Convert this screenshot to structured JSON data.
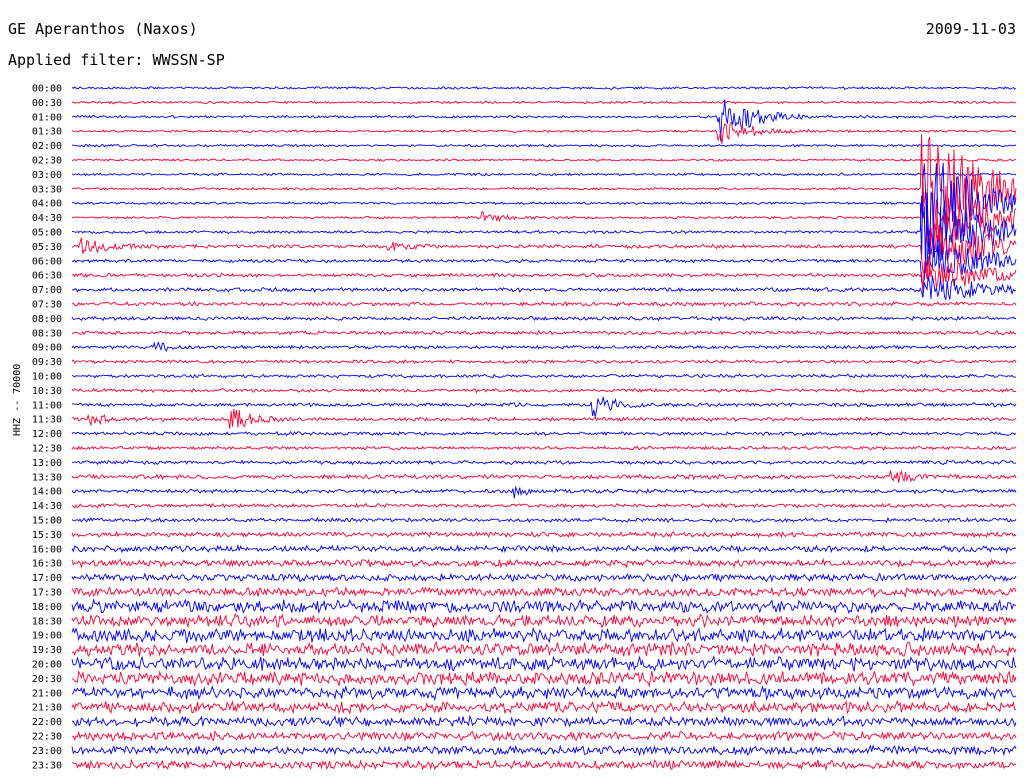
{
  "header": {
    "title": "GE Aperanthos (Naxos)",
    "filter": "Applied filter: WWSSN-SP",
    "date": "2009-11-03",
    "channel": "HHZ -- 70000"
  },
  "colors": {
    "odd": "#0000ff",
    "even": "#ff0033"
  },
  "chart_data": {
    "type": "line",
    "title": "GE Aperanthos (Naxos)",
    "xlabel": "",
    "ylabel": "HHZ -- 70000",
    "row_labels": [
      "00:00",
      "00:30",
      "01:00",
      "01:30",
      "02:00",
      "02:30",
      "03:00",
      "03:30",
      "04:00",
      "04:30",
      "05:00",
      "05:30",
      "06:00",
      "06:30",
      "07:00",
      "07:30",
      "08:00",
      "08:30",
      "09:00",
      "09:30",
      "10:00",
      "10:30",
      "11:00",
      "11:30",
      "12:00",
      "12:30",
      "13:00",
      "13:30",
      "14:00",
      "14:30",
      "15:00",
      "15:30",
      "16:00",
      "16:30",
      "17:00",
      "17:30",
      "18:00",
      "18:30",
      "19:00",
      "19:30",
      "20:00",
      "20:30",
      "21:00",
      "21:30",
      "22:00",
      "22:30",
      "23:00",
      "23:30"
    ],
    "row_minutes": 30,
    "noise_level": [
      1,
      1,
      1,
      1,
      1,
      1,
      1,
      1,
      1,
      1,
      1.2,
      1.5,
      1.4,
      1.5,
      1.6,
      1.6,
      1.5,
      1.5,
      1.4,
      1.4,
      1.4,
      1.4,
      1.5,
      1.5,
      1.4,
      1.4,
      1.6,
      1.8,
      1.6,
      1.6,
      1.6,
      2,
      2.5,
      2.8,
      3,
      3.5,
      5,
      5,
      5.5,
      5.5,
      5.5,
      5.5,
      5,
      4.5,
      4,
      3.5,
      3.5,
      3.5
    ],
    "events": [
      {
        "row": 2,
        "minute": 20.5,
        "amplitude": 28,
        "duration_min": 1.5
      },
      {
        "row": 3,
        "minute": 20.5,
        "amplitude": 14,
        "duration_min": 1.5
      },
      {
        "row": 7,
        "minute": 27,
        "amplitude": 70,
        "duration_min": 3
      },
      {
        "row": 8,
        "minute": 27,
        "amplitude": 60,
        "duration_min": 3
      },
      {
        "row": 9,
        "minute": 27,
        "amplitude": 50,
        "duration_min": 3
      },
      {
        "row": 10,
        "minute": 27,
        "amplitude": 45,
        "duration_min": 3
      },
      {
        "row": 11,
        "minute": 27,
        "amplitude": 35,
        "duration_min": 3
      },
      {
        "row": 12,
        "minute": 27,
        "amplitude": 25,
        "duration_min": 3
      },
      {
        "row": 13,
        "minute": 27,
        "amplitude": 20,
        "duration_min": 3
      },
      {
        "row": 14,
        "minute": 27,
        "amplitude": 15,
        "duration_min": 3
      },
      {
        "row": 9,
        "minute": 13,
        "amplitude": 6,
        "duration_min": 1
      },
      {
        "row": 11,
        "minute": 10,
        "amplitude": 7,
        "duration_min": 0.7
      },
      {
        "row": 11,
        "minute": 0.2,
        "amplitude": 8,
        "duration_min": 1.5
      },
      {
        "row": 18,
        "minute": 2.5,
        "amplitude": 8,
        "duration_min": 0.7
      },
      {
        "row": 22,
        "minute": 16.5,
        "amplitude": 14,
        "duration_min": 1
      },
      {
        "row": 23,
        "minute": 5,
        "amplitude": 14,
        "duration_min": 1
      },
      {
        "row": 23,
        "minute": 0.5,
        "amplitude": 6,
        "duration_min": 1
      },
      {
        "row": 27,
        "minute": 26,
        "amplitude": 8,
        "duration_min": 1
      },
      {
        "row": 28,
        "minute": 14,
        "amplitude": 7,
        "duration_min": 0.5
      }
    ]
  }
}
